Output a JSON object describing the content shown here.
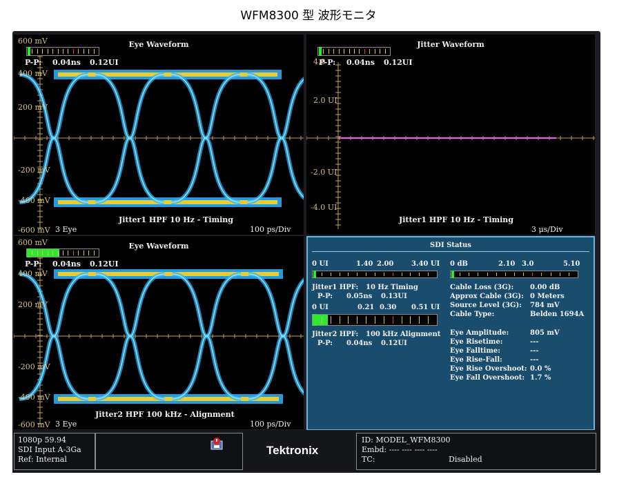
{
  "doc_title": "WFM8300 型  波形モニタ",
  "colors": {
    "trace": "#2db4ff",
    "hot": "#ffd21f",
    "axis": "#bfa25a",
    "jitter": "#ff55ff",
    "sdi_bg": "#1a4d6d"
  },
  "eye_top": {
    "title": "Eye Waveform",
    "label_top": "600 mV",
    "pp_label": "P-P:",
    "pp_ns": "0.04ns",
    "pp_ui": "0.12UI",
    "y_labels": [
      "400 mV",
      "200 mV",
      "-200 mV",
      "-400 mV",
      "-600 mV"
    ],
    "mode": "3 Eye",
    "filter": "Jitter1 HPF 10 Hz - Timing",
    "scale": "100 ps/Div"
  },
  "jitter": {
    "title": "Jitter Waveform",
    "pp_label": "P-P:",
    "pp_ns": "0.04ns",
    "pp_ui": "0.12UI",
    "y_top": "4.0",
    "y_labels": [
      "2.0 UI",
      "-2.0 UI",
      "-4.0 UI"
    ],
    "filter": "Jitter1 HPF 10 Hz - Timing",
    "scale": "3 μs/Div"
  },
  "eye_bottom": {
    "title": "Eye Waveform",
    "label_top": "600 mV",
    "pp_label": "P-P:",
    "pp_ns": "0.04ns",
    "pp_ui": "0.12UI",
    "y_labels": [
      "400 mV",
      "200 mV",
      "-200 mV",
      "-400 mV",
      "-600 mV"
    ],
    "mode": "3 Eye",
    "filter": "Jitter2 HPF 100 kHz - Alignment",
    "scale": "100 ps/Div",
    "meter_fill": 0.45
  },
  "sdi": {
    "title": "SDI Status",
    "jitter1_scale": [
      "0 UI",
      "1.40",
      "2.00",
      "3.40 UI"
    ],
    "jitter1_label": "Jitter1 HPF:",
    "jitter1_value": "10 Hz Timing",
    "jitter1_pp_label": "P-P:",
    "jitter1_pp_ns": "0.05ns",
    "jitter1_pp_ui": "0.13UI",
    "jitter2_scale": [
      "0 UI",
      "0.21",
      "0.30",
      "0.51 UI"
    ],
    "jitter2_label": "Jitter2 HPF:",
    "jitter2_value": "100 kHz Alignment",
    "jitter2_pp_label": "P-P:",
    "jitter2_pp_ns": "0.04ns",
    "jitter2_pp_ui": "0.12UI",
    "jitter2_fill": 0.12,
    "cable_scale": [
      "0 dB",
      "2.10",
      "3.0",
      "5.10"
    ],
    "cable_rows": [
      {
        "label": "Cable Loss (3G):",
        "value": "0.00 dB"
      },
      {
        "label": "Approx Cable (3G):",
        "value": "0 Meters"
      },
      {
        "label": "Source Level (3G):",
        "value": "784 mV"
      },
      {
        "label": "Cable Type:",
        "value": "Belden 1694A"
      }
    ],
    "eye_rows": [
      {
        "label": "Eye Amplitude:",
        "value": "805 mV"
      },
      {
        "label": "Eye Risetime:",
        "value": "---"
      },
      {
        "label": "Eye Falltime:",
        "value": "---"
      },
      {
        "label": "Eye Rise-Fall:",
        "value": "---"
      },
      {
        "label": "Eye Rise Overshoot:",
        "value": "0.0 %"
      },
      {
        "label": "Eye Fall Overshoot:",
        "value": "1.7 %"
      }
    ]
  },
  "status": {
    "format": "1080p 59.94",
    "input": "SDI Input A-3Ga",
    "ref": "Ref: Internal",
    "alarm_icon": "alarm-icon",
    "brand": "Tektronix",
    "id": "ID: MODEL_WFM8300",
    "embd": "Embd: ---- ---- ---- ----",
    "tc_label": "TC:",
    "tc_value": "Disabled"
  }
}
